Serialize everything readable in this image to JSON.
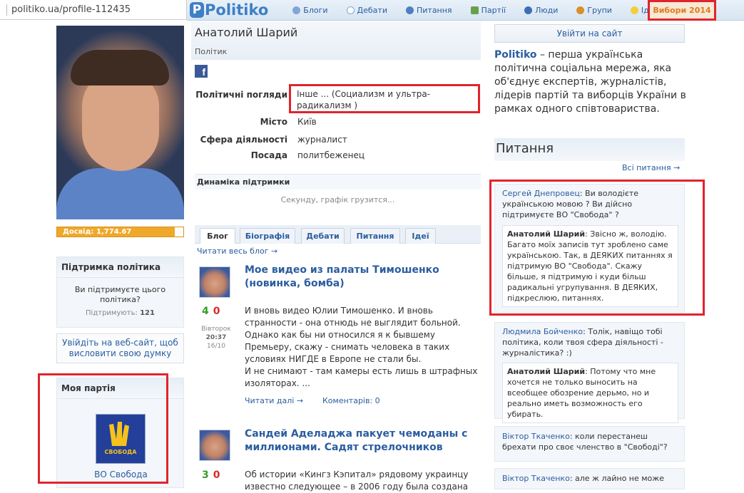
{
  "browser": {
    "url": "politiko.ua/profile-112435"
  },
  "nav": {
    "brand": "Politiko",
    "items": [
      {
        "label": "Блоги",
        "icon": "blog-icon"
      },
      {
        "label": "Дебати",
        "icon": "speech-bubble-icon"
      },
      {
        "label": "Питання",
        "icon": "question-icon"
      },
      {
        "label": "Партії",
        "icon": "party-icon"
      },
      {
        "label": "Люди",
        "icon": "people-icon"
      },
      {
        "label": "Групи",
        "icon": "group-icon"
      },
      {
        "label": "Ідеї",
        "icon": "lightbulb-icon"
      }
    ],
    "elections": "Вибори 2014"
  },
  "profile": {
    "name": "Анатолий Шарий",
    "role": "Політик",
    "rating": "Досвід: 1,774.67",
    "rating_fraction": 0.93,
    "fields": [
      {
        "label": "Політичні погляди",
        "value": "Інше ... (Социализм и ультра-радикализм )"
      },
      {
        "label": "Місто",
        "value": "Київ"
      },
      {
        "label": "Сфера діяльності",
        "value": "журналист"
      },
      {
        "label": "Посада",
        "value": "политбеженец"
      }
    ]
  },
  "support": {
    "title": "Підтримка політика",
    "question": "Ви підтримуєте цього політика?",
    "count_label": "Підтримують:",
    "count": "121"
  },
  "login_prompt": "Увійдіть на веб-сайт, щоб висловити свою думку",
  "party": {
    "title": "Моя партія",
    "logo_text": "СВОБОДА",
    "name": "ВО Свобода"
  },
  "dynamics": {
    "title": "Динаміка підтримки",
    "loading": "Секунду, графік грузится..."
  },
  "tabs": [
    "Блог",
    "Біографія",
    "Дебати",
    "Питання",
    "Ідеї"
  ],
  "blog": {
    "read_all": "Читати весь блог →",
    "posts": [
      {
        "title": "Мое видео из палаты Тимошенко (новинка, бомба)",
        "up": "4",
        "down": "0",
        "day": "Вівторок",
        "time": "20:37",
        "date": "16/10",
        "text": [
          "И вновь видео Юлии Тимошенко. И вновь странности - она отнюдь не выглядит больной.",
          "Однако как бы ни относился я к бывшему Премьеру, скажу - снимать человека в таких условиях НИГДЕ в Европе не стали бы.",
          "И не снимают - там камеры есть лишь в штрафных изоляторах. ..."
        ],
        "read_more": "Читати далі →",
        "comments": "Коментарів: 0"
      },
      {
        "title": "Сандей Аделаджа пакует чемоданы с миллионами. Садят стрелочников",
        "up": "3",
        "down": "0",
        "text": [
          "Об истории «Кингз Кэпитал» рядовому украинцу известно следующее – в 2006 году была создана"
        ]
      }
    ]
  },
  "right": {
    "login_button": "Увійти на сайт",
    "about_brand": "Politiko",
    "about_text": " – перша українська політична соціальна мережа, яка об'єднує експертів, журналістів, лідерів партій та виборців України в рамках одного співтовариства.",
    "questions_title": "Питання",
    "all_questions": "Всі питання →",
    "questions": [
      {
        "author": "Сергей Днепровец",
        "text": ": Ви володієте українською мовою ? Ви дійсно підтримуєте ВО \"Свобода\" ?",
        "answer_author": "Анатолий Шарий",
        "answer": ": Звісно ж, володію. Багато моїх записів тут зроблено саме українською. Так, в ДЕЯКИХ питаннях я підтримую ВО \"Свобода\". Скажу більше, я підтримую і куди більш радикальні угрупування. В ДЕЯКИХ, підкреслюю, питаннях."
      },
      {
        "author": "Людмила Бойченко",
        "text": ": Толік, навіщо тобі політика, коли твоя сфера діяльності - журналістика? :)",
        "answer_author": "Анатолий Шарий",
        "answer": ": Потому что мне хочется не только выносить на всеобщее обозрение дерьмо, но и реально иметь возможность его убирать."
      },
      {
        "author": "Віктор Ткаченко",
        "text": ": коли перестанеш брехати про своє членство в \"Свободі\"?"
      },
      {
        "author": "Віктор Ткаченко",
        "text": ": але ж лайно не може"
      }
    ]
  }
}
